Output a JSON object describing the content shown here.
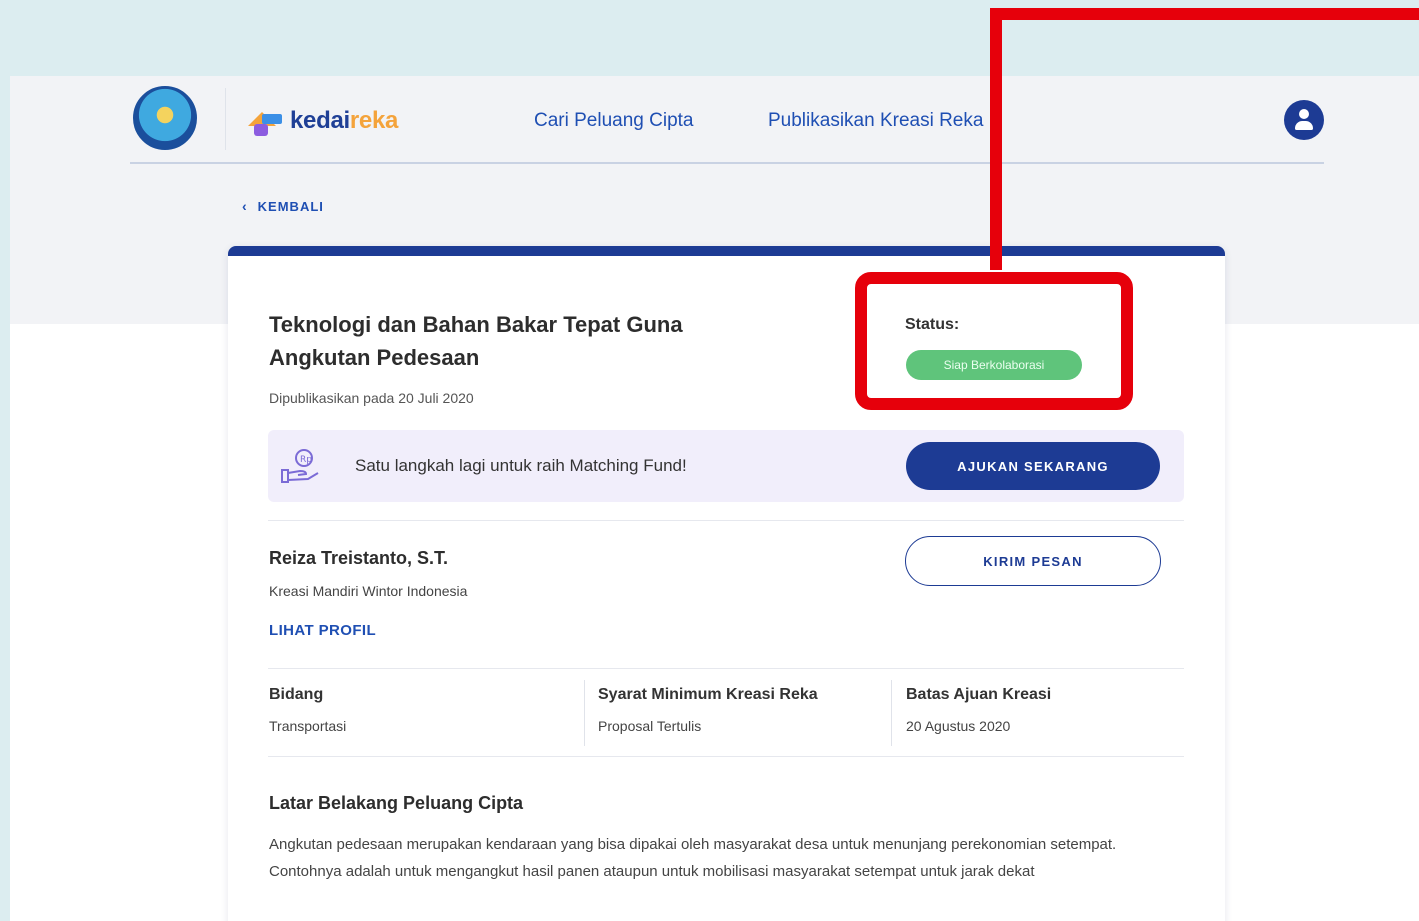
{
  "nav": {
    "brand_part1": "kedai",
    "brand_part2": "reka",
    "link1": "Cari Peluang Cipta",
    "link2": "Publikasikan Kreasi Reka"
  },
  "back_label": "KEMBALI",
  "opportunity": {
    "title": "Teknologi dan Bahan Bakar Tepat Guna Angkutan Pedesaan",
    "published": "Dipublikasikan pada 20 Juli 2020",
    "status_label": "Status:",
    "status_value": "Siap Berkolaborasi"
  },
  "banner": {
    "text": "Satu langkah lagi untuk raih Matching Fund!",
    "button": "AJUKAN SEKARANG"
  },
  "owner": {
    "name": "Reiza Treistanto, S.T.",
    "organization": "Kreasi Mandiri Wintor Indonesia",
    "profile_link": "LIHAT PROFIL",
    "message_button": "KIRIM PESAN"
  },
  "info": [
    {
      "label": "Bidang",
      "value": "Transportasi"
    },
    {
      "label": "Syarat Minimum Kreasi Reka",
      "value": "Proposal Tertulis"
    },
    {
      "label": "Batas Ajuan Kreasi",
      "value": "20 Agustus 2020"
    }
  ],
  "background": {
    "title": "Latar Belakang Peluang Cipta",
    "body": "Angkutan pedesaan merupakan kendaraan yang bisa dipakai oleh masyarakat desa untuk menunjang perekonomian setempat. Contohnya adalah untuk mengangkut hasil panen ataupun untuk mobilisasi masyarakat setempat untuk jarak dekat"
  },
  "colors": {
    "primary": "#1d3b94",
    "link": "#1f4fb3",
    "status_green": "#5fc47b",
    "highlight_red": "#e6000b",
    "brand_orange": "#f4a33b"
  }
}
